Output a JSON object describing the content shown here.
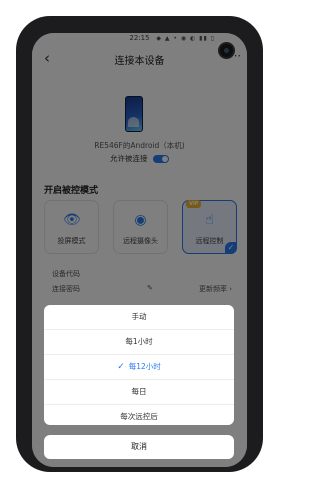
{
  "status_bar": {
    "time": "22:15",
    "icons": "◆ ▲ • ◉ ◐ ▮▮ ▯"
  },
  "header": {
    "back_icon": "‹",
    "title": "连接本设备",
    "more_icon": "⋯"
  },
  "device": {
    "name": "RE546F的Android（本机)",
    "allow_label": "允许被连接",
    "allow_enabled": true
  },
  "section_title": "开启被控模式",
  "modes": [
    {
      "label": "投屏模式",
      "icon": "eye-icon",
      "glyph": "👁"
    },
    {
      "label": "远程摄像头",
      "icon": "camera-icon",
      "glyph": "◉"
    },
    {
      "label": "远程控制",
      "icon": "touch-icon",
      "glyph": "☝",
      "badge": "VIP",
      "selected": true
    }
  ],
  "info": {
    "code_label": "设备代码",
    "password_label": "连接密码",
    "refresh_label": "更新频率 ›"
  },
  "sheet": {
    "options": [
      {
        "label": "手动",
        "selected": false
      },
      {
        "label": "每1小时",
        "selected": false
      },
      {
        "label": "每12小时",
        "selected": true
      },
      {
        "label": "每日",
        "selected": false
      },
      {
        "label": "每次远控后",
        "selected": false
      }
    ],
    "cancel_label": "取消"
  },
  "colors": {
    "accent": "#2a7af0",
    "vip": "#f0b52e",
    "overlay": "rgba(0,0,0,0.5)"
  }
}
